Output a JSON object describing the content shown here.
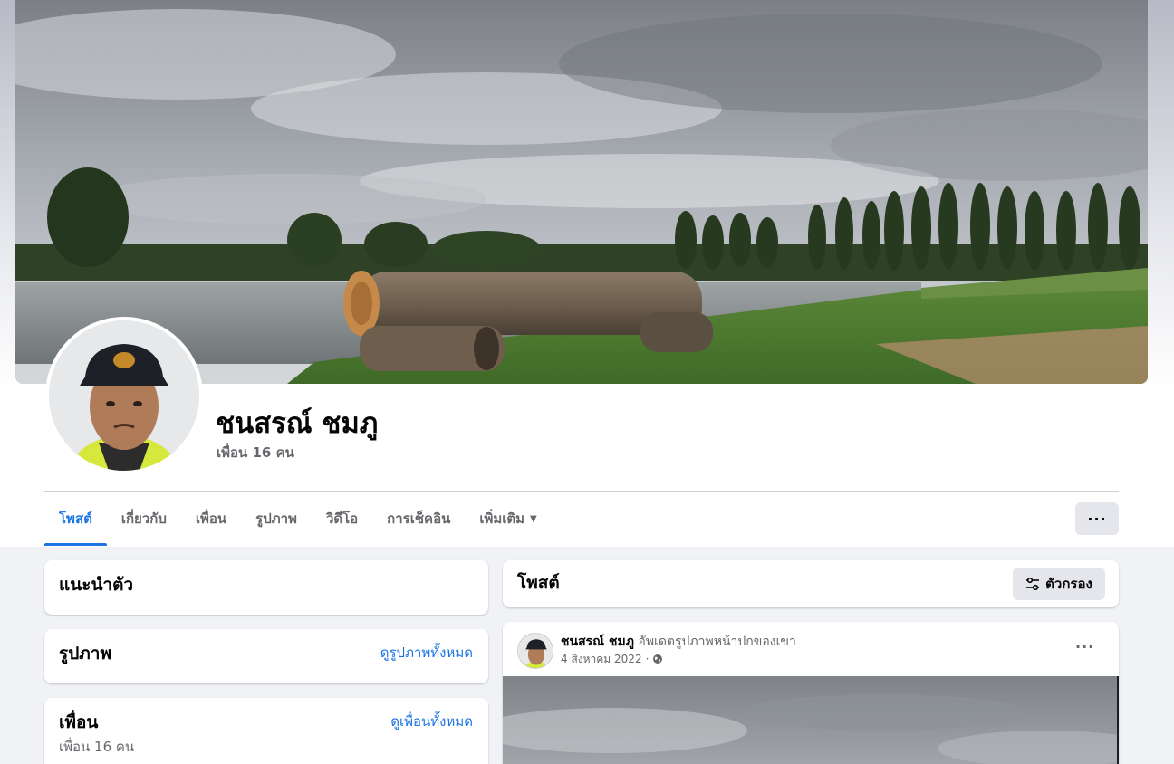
{
  "profile": {
    "name": "ชนสรณ์ ชมภู",
    "friends_count": "เพื่อน 16 คน"
  },
  "tabs": [
    {
      "label": "โพสต์",
      "active": true
    },
    {
      "label": "เกี่ยวกับ",
      "active": false
    },
    {
      "label": "เพื่อน",
      "active": false
    },
    {
      "label": "รูปภาพ",
      "active": false
    },
    {
      "label": "วิดีโอ",
      "active": false
    },
    {
      "label": "การเช็คอิน",
      "active": false
    },
    {
      "label": "เพิ่มเติม",
      "active": false
    }
  ],
  "more_button_label": "···",
  "intro": {
    "title": "แนะนำตัว"
  },
  "photos": {
    "title": "รูปภาพ",
    "link": "ดูรูปภาพทั้งหมด"
  },
  "friends": {
    "title": "เพื่อน",
    "link": "ดูเพื่อนทั้งหมด",
    "count": "เพื่อน 16 คน"
  },
  "posts": {
    "title": "โพสต์",
    "filter_label": "ตัวกรอง"
  },
  "post": {
    "author": "ชนสรณ์ ชมภู",
    "action": "อัพเดตรูปภาพหน้าปกของเขา",
    "date": "4 สิงหาคม 2022",
    "separator": "·",
    "menu": "···"
  },
  "colors": {
    "accent": "#1b74e4",
    "background": "#f0f2f5",
    "secondary_text": "#65676b",
    "button_gray": "#e4e6eb"
  },
  "icons": [
    "caret-down-icon",
    "more-dots-icon",
    "filter-sliders-icon",
    "globe-icon"
  ]
}
